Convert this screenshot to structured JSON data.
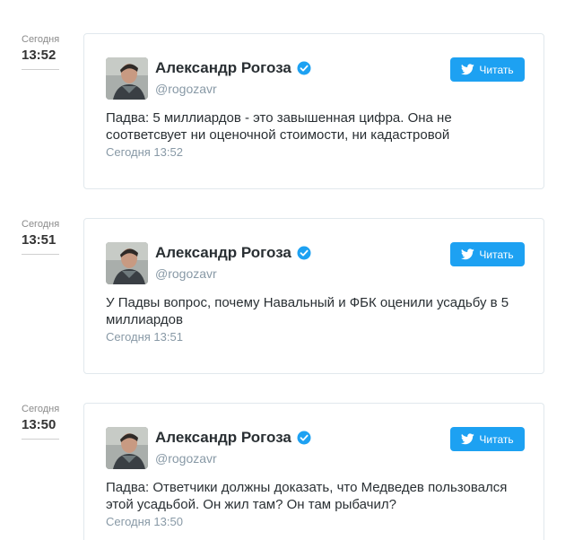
{
  "entries": [
    {
      "time_label": "Сегодня",
      "time": "13:52",
      "author": "Александр Рогоза",
      "handle": "@rogozavr",
      "follow_label": "Читать",
      "text": "Падва: 5 миллиардов - это завышенная цифра. Она не соответсвует ни оценочной стоимости, ни кадастровой",
      "timestamp": "Сегодня 13:52"
    },
    {
      "time_label": "Сегодня",
      "time": "13:51",
      "author": "Александр Рогоза",
      "handle": "@rogozavr",
      "follow_label": "Читать",
      "text": "У Падвы вопрос, почему Навальный и ФБК оценили усадьбу в 5 миллиардов",
      "timestamp": "Сегодня 13:51"
    },
    {
      "time_label": "Сегодня",
      "time": "13:50",
      "author": "Александр Рогоза",
      "handle": "@rogozavr",
      "follow_label": "Читать",
      "text": "Падва: Ответчики должны доказать, что Медведев пользовался этой усадьбой. Он жил там? Он там рыбачил?",
      "timestamp": "Сегодня 13:50"
    }
  ],
  "colors": {
    "accent": "#1da1f2",
    "muted": "#8899a6",
    "text": "#292f33",
    "border": "#e1e8ed"
  },
  "icons": {
    "verified": "verified-badge-icon",
    "bird": "twitter-bird-icon"
  }
}
